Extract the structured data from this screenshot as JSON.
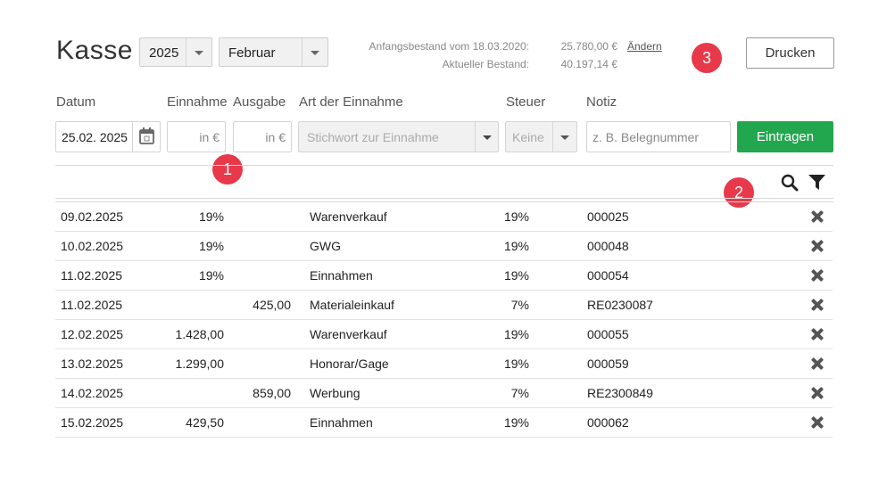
{
  "header": {
    "title": "Kasse",
    "year": "2025",
    "month": "Februar",
    "opening_label": "Anfangsbestand vom 18.03.2020:",
    "opening_value": "25.780,00 €",
    "change_link": "Ändern",
    "current_label": "Aktueller Bestand:",
    "current_value": "40.197,14 €",
    "print_label": "Drucken"
  },
  "badges": [
    "1",
    "2",
    "3"
  ],
  "form": {
    "labels": {
      "date": "Datum",
      "income": "Einnahme",
      "expense": "Ausgabe",
      "type": "Art der Einnahme",
      "tax": "Steuer",
      "note": "Notiz"
    },
    "date_value": "25.02. 2025",
    "income_placeholder": "in €",
    "expense_placeholder": "in €",
    "type_placeholder": "Stichwort zur Einnahme",
    "tax_value": "Keine",
    "note_placeholder": "z. B. Belegnummer",
    "submit_label": "Eintragen"
  },
  "toolbar": {
    "search_icon": "search-icon",
    "filter_icon": "filter-icon"
  },
  "rows": [
    {
      "date": "09.02.2025",
      "income": "19%",
      "expense": "",
      "type": "Warenverkauf",
      "tax": "19%",
      "note": "000025"
    },
    {
      "date": "10.02.2025",
      "income": "19%",
      "expense": "",
      "type": "GWG",
      "tax": "19%",
      "note": "000048"
    },
    {
      "date": "11.02.2025",
      "income": "19%",
      "expense": "",
      "type": "Einnahmen",
      "tax": "19%",
      "note": "000054"
    },
    {
      "date": "11.02.2025",
      "income": "",
      "expense": "425,00",
      "type": "Materialeinkauf",
      "tax": "7%",
      "note": "RE0230087"
    },
    {
      "date": "12.02.2025",
      "income": "1.428,00",
      "expense": "",
      "type": "Warenverkauf",
      "tax": "19%",
      "note": "000055"
    },
    {
      "date": "13.02.2025",
      "income": "1.299,00",
      "expense": "",
      "type": "Honorar/Gage",
      "tax": "19%",
      "note": "000059"
    },
    {
      "date": "14.02.2025",
      "income": "",
      "expense": "859,00",
      "type": "Werbung",
      "tax": "7%",
      "note": "RE2300849"
    },
    {
      "date": "15.02.2025",
      "income": "429,50",
      "expense": "",
      "type": "Einnahmen",
      "tax": "19%",
      "note": "000062"
    }
  ]
}
